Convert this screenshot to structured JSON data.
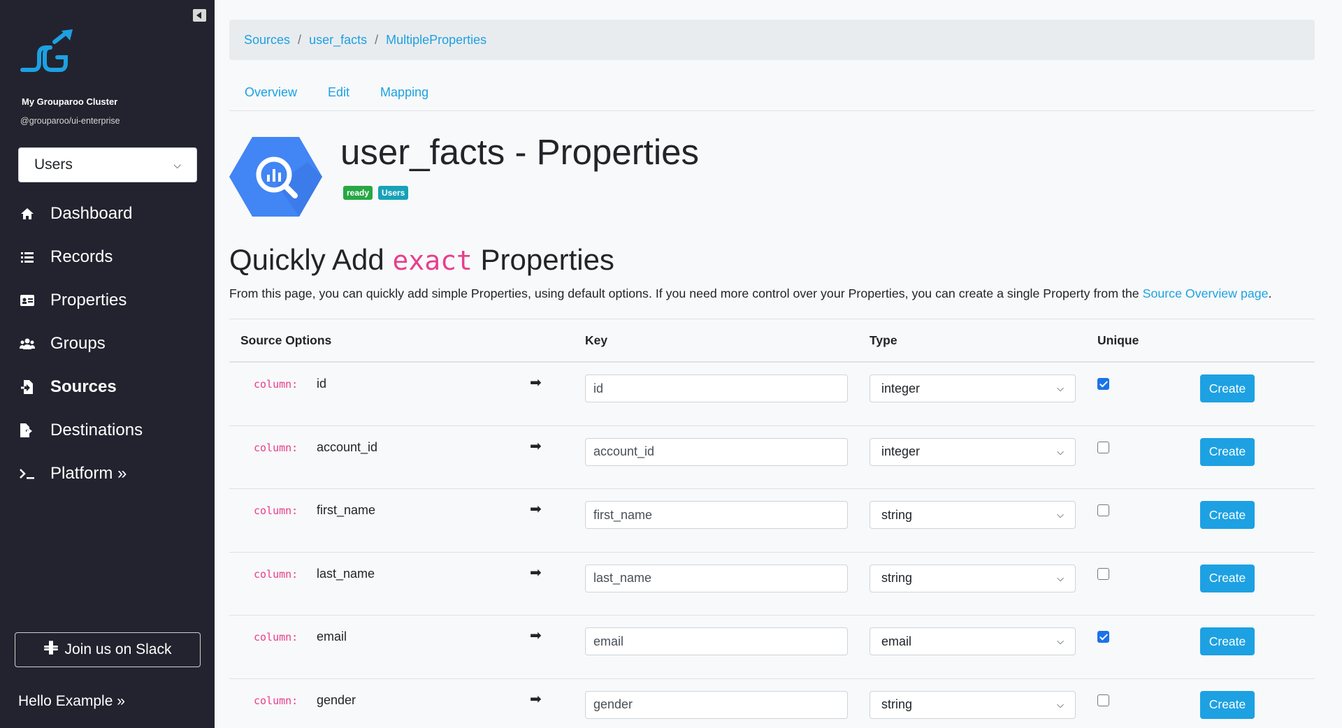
{
  "sidebar": {
    "cluster_name": "My Grouparoo Cluster",
    "cluster_package": "@grouparoo/ui-enterprise",
    "model_select": "Users",
    "nav": [
      {
        "label": "Dashboard",
        "icon": "home-icon"
      },
      {
        "label": "Records",
        "icon": "list-icon"
      },
      {
        "label": "Properties",
        "icon": "id-card-icon"
      },
      {
        "label": "Groups",
        "icon": "users-icon"
      },
      {
        "label": "Sources",
        "icon": "file-import-icon",
        "active": true
      },
      {
        "label": "Destinations",
        "icon": "file-export-icon"
      },
      {
        "label": "Platform »",
        "icon": "terminal-icon"
      }
    ],
    "slack_label": "Join us on Slack",
    "hello": "Hello Example »"
  },
  "breadcrumb": [
    "Sources",
    "user_facts",
    "MultipleProperties"
  ],
  "tabs": [
    "Overview",
    "Edit",
    "Mapping"
  ],
  "header": {
    "title": "user_facts - Properties",
    "badge_state": "ready",
    "badge_model": "Users"
  },
  "section": {
    "heading_prefix": "Quickly Add",
    "heading_code": "exact",
    "heading_suffix": "Properties",
    "intro_text": "From this page, you can quickly add simple Properties, using default options. If you need more control over your Properties, you can create a single Property from the",
    "intro_link": "Source Overview page",
    "intro_end": "."
  },
  "table": {
    "headers": {
      "source_options": "Source Options",
      "key": "Key",
      "type": "Type",
      "unique": "Unique"
    },
    "column_label": "column:",
    "arrow": "➡",
    "create_label": "Create",
    "rows": [
      {
        "column": "id",
        "key": "id",
        "type": "integer",
        "unique": true
      },
      {
        "column": "account_id",
        "key": "account_id",
        "type": "integer",
        "unique": false
      },
      {
        "column": "first_name",
        "key": "first_name",
        "type": "string",
        "unique": false
      },
      {
        "column": "last_name",
        "key": "last_name",
        "type": "string",
        "unique": false
      },
      {
        "column": "email",
        "key": "email",
        "type": "email",
        "unique": true
      },
      {
        "column": "gender",
        "key": "gender",
        "type": "string",
        "unique": false
      }
    ]
  },
  "colors": {
    "sidebar_bg": "#23232f",
    "link": "#1da1e2",
    "code": "#e83e8c",
    "ready": "#28a745",
    "model_badge": "#17a2b8"
  }
}
